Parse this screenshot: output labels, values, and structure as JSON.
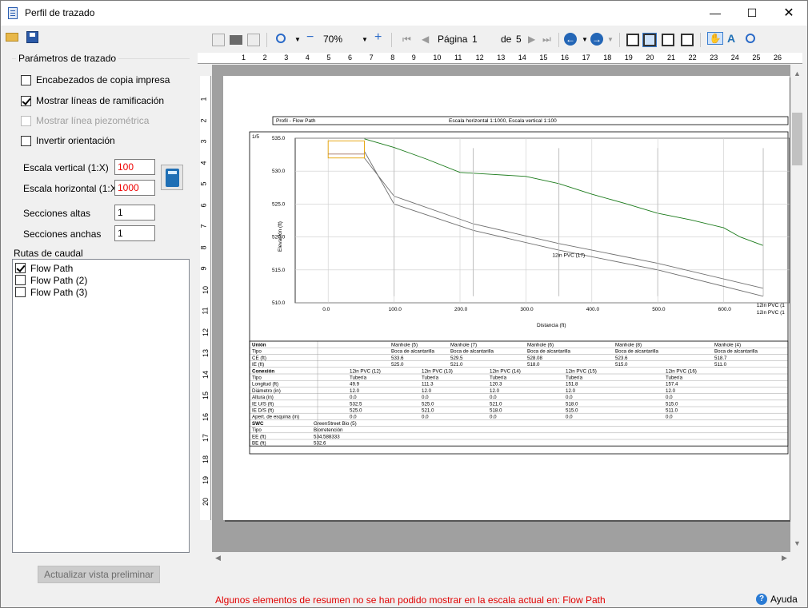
{
  "window": {
    "title": "Perfil de trazado"
  },
  "params": {
    "group_title": "Parámetros de trazado",
    "chk_encabezados": "Encabezados de copia impresa",
    "chk_ramificacion": "Mostrar líneas de ramificación",
    "chk_piezometrica": "Mostrar línea piezométrica",
    "chk_invertir": "Invertir orientación",
    "escala_vertical_label": "Escala vertical (1:X)",
    "escala_vertical_value": "100",
    "escala_horizontal_label": "Escala horizontal (1:X)",
    "escala_horizontal_value": "1000",
    "secciones_altas_label": "Secciones altas",
    "secciones_altas_value": "1",
    "secciones_anchas_label": "Secciones anchas",
    "secciones_anchas_value": "1"
  },
  "rutas": {
    "label": "Rutas de caudal",
    "items": [
      "Flow Path",
      "Flow Path (2)",
      "Flow Path (3)"
    ]
  },
  "update_button": "Actualizar vista preliminar",
  "preview_toolbar": {
    "zoom": "70%",
    "page_label": "Página",
    "page_value": "1",
    "of_label": "de",
    "total_pages": "5"
  },
  "ruler_top": [
    "1",
    "2",
    "3",
    "4",
    "5",
    "6",
    "7",
    "8",
    "9",
    "10",
    "11",
    "12",
    "13",
    "14",
    "15",
    "16",
    "17",
    "18",
    "19",
    "20",
    "21",
    "22",
    "23",
    "24",
    "25",
    "26"
  ],
  "ruler_left": [
    "1",
    "2",
    "3",
    "4",
    "5",
    "6",
    "7",
    "8",
    "9",
    "10",
    "11",
    "12",
    "13",
    "14",
    "15",
    "16",
    "17",
    "18",
    "19",
    "20"
  ],
  "sheet": {
    "header_left": "Profil - Flow Path",
    "header_center": "Escala horizontal 1:1000, Escala vertical 1:100",
    "page_marker": "1/5"
  },
  "chart_data": {
    "type": "line",
    "xlabel": "Distancia (ft)",
    "ylabel": "Elevación (ft)",
    "xlim": [
      -50,
      700
    ],
    "ylim": [
      510,
      535
    ],
    "x_ticks": [
      "0.0",
      "100.0",
      "200.0",
      "300.0",
      "400.0",
      "500.0",
      "600.0"
    ],
    "y_ticks": [
      "510.0",
      "515.0",
      "520.0",
      "525.0",
      "530.0",
      "535.0"
    ],
    "series": [
      {
        "values": [
          [
            55,
            534.9
          ],
          [
            100,
            533.6
          ],
          [
            150,
            531.8
          ],
          [
            200,
            529.8
          ],
          [
            250,
            529.5
          ],
          [
            300,
            529.2
          ],
          [
            350,
            528.1
          ],
          [
            400,
            526.5
          ],
          [
            450,
            525.1
          ],
          [
            500,
            523.6
          ],
          [
            550,
            522.6
          ],
          [
            600,
            521.4
          ],
          [
            625,
            520.0
          ],
          [
            660,
            518.7
          ]
        ]
      },
      {
        "values": [
          [
            55,
            533.0
          ],
          [
            100,
            525.0
          ],
          [
            220,
            521.0
          ],
          [
            350,
            518.0
          ],
          [
            500,
            515.0
          ],
          [
            660,
            511.0
          ]
        ]
      },
      {
        "values": [
          [
            55,
            532.0
          ],
          [
            100,
            526.2
          ],
          [
            220,
            522.0
          ],
          [
            350,
            519.0
          ],
          [
            500,
            516.0
          ],
          [
            660,
            512.2
          ]
        ]
      }
    ],
    "annotations": [
      "12in PVC (17)",
      "12in PVC (1",
      "12in PVC (1"
    ]
  },
  "table": {
    "union_rows": [
      [
        "Unión",
        "",
        "Manhole (5)",
        "Manhole (7)",
        "Manhole (6)",
        "Manhole (8)",
        "Manhole (4)"
      ],
      [
        "Tipo",
        "",
        "Boca de alcantarilla",
        "Boca de alcantarilla",
        "Boca de alcantarilla",
        "Boca de alcantarilla",
        "Boca de alcantarilla"
      ],
      [
        "CE (ft)",
        "",
        "533.6",
        "529.5",
        "528.08",
        "523.6",
        "518.7"
      ],
      [
        "IE (ft)",
        "",
        "525.0",
        "521.0",
        "518.0",
        "515.0",
        "511.0"
      ]
    ],
    "conexion_rows": [
      [
        "Conexión",
        "12in PVC (12)",
        "12in PVC (13)",
        "12in PVC (14)",
        "12in PVC (15)",
        "12in PVC (16)"
      ],
      [
        "Tipo",
        "Tubería",
        "Tubería",
        "Tubería",
        "Tubería",
        "Tubería"
      ],
      [
        "Longitud (ft)",
        "49.9",
        "111.3",
        "120.3",
        "151.8",
        "157.4"
      ],
      [
        "Diámetro (in)",
        "12.0",
        "12.0",
        "12.0",
        "12.0",
        "12.0"
      ],
      [
        "Altura (in)",
        "0.0",
        "0.0",
        "0.0",
        "0.0",
        "0.0"
      ],
      [
        "IE U/S (ft)",
        "532.5",
        "525.0",
        "521.0",
        "518.0",
        "515.0"
      ],
      [
        "IE D/S (ft)",
        "525.0",
        "521.0",
        "518.0",
        "515.0",
        "511.0"
      ],
      [
        "Apert. de esquina (in)",
        "0.0",
        "0.0",
        "0.0",
        "0.0",
        "0.0"
      ]
    ],
    "swc_rows": [
      [
        "SWC",
        "GreenStreet Bio (5)"
      ],
      [
        "Tipo",
        "Biorretención"
      ],
      [
        "EE (ft)",
        "534.588333"
      ],
      [
        "BE (ft)",
        "532.6"
      ]
    ]
  },
  "status_message": "Algunos elementos de resumen no se han podido mostrar en la escala actual en: Flow Path",
  "help_label": "Ayuda"
}
